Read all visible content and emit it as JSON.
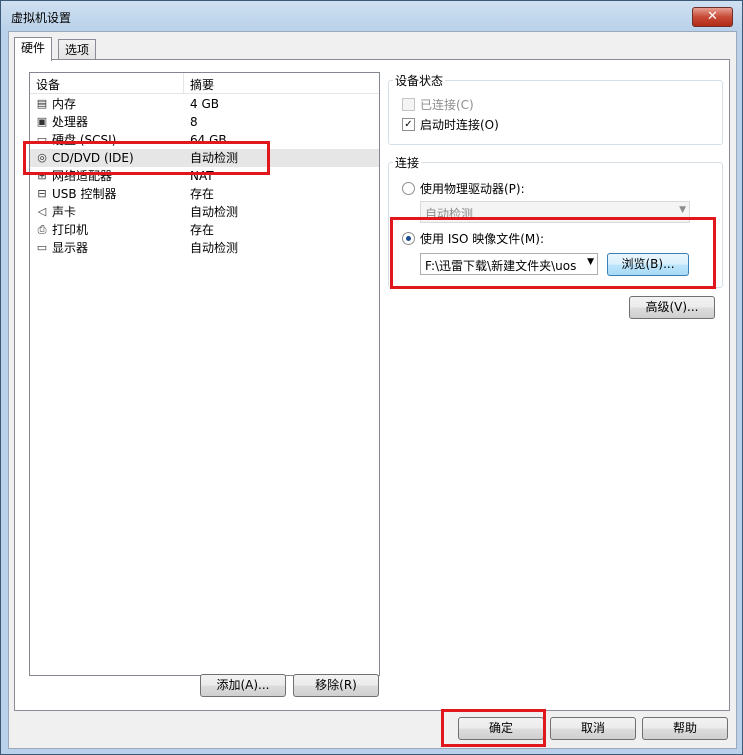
{
  "window": {
    "title": "虚拟机设置",
    "close_label": "✕"
  },
  "tabs": [
    {
      "label": "硬件",
      "active": true
    },
    {
      "label": "选项",
      "active": false
    }
  ],
  "device_list": {
    "columns": [
      "设备",
      "摘要"
    ],
    "rows": [
      {
        "icon": "memory-icon",
        "glyph": "▤",
        "name": "内存",
        "summary": "4 GB"
      },
      {
        "icon": "processor-icon",
        "glyph": "▣",
        "name": "处理器",
        "summary": "8"
      },
      {
        "icon": "hard-disk-icon",
        "glyph": "▭",
        "name": "硬盘 (SCSI)",
        "summary": "64 GB"
      },
      {
        "icon": "cd-dvd-icon",
        "glyph": "◎",
        "name": "CD/DVD (IDE)",
        "summary": "自动检测",
        "selected": true
      },
      {
        "icon": "network-adapter-icon",
        "glyph": "⊞",
        "name": "网络适配器",
        "summary": "NAT"
      },
      {
        "icon": "usb-icon",
        "glyph": "⊟",
        "name": "USB 控制器",
        "summary": "存在"
      },
      {
        "icon": "speaker-icon",
        "glyph": "◁",
        "name": "声卡",
        "summary": "自动检测"
      },
      {
        "icon": "printer-icon",
        "glyph": "⎙",
        "name": "打印机",
        "summary": "存在"
      },
      {
        "icon": "display-icon",
        "glyph": "▭",
        "name": "显示器",
        "summary": "自动检测"
      }
    ]
  },
  "device_status": {
    "label": "设备状态",
    "connected": {
      "label": "已连接(C)",
      "checked": false,
      "enabled": false
    },
    "connect_at_power_on": {
      "label": "启动时连接(O)",
      "checked": true
    }
  },
  "connection": {
    "label": "连接",
    "physical_drive": {
      "label": "使用物理驱动器(P):",
      "selected": false,
      "value": "自动检测"
    },
    "iso_image": {
      "label": "使用 ISO 映像文件(M):",
      "selected": true,
      "path": "F:\\迅雷下载\\新建文件夹\\uos"
    },
    "browse_label": "浏览(B)...",
    "advanced_label": "高级(V)..."
  },
  "list_buttons": {
    "add": "添加(A)...",
    "remove": "移除(R)"
  },
  "dialog_buttons": {
    "ok": "确定",
    "cancel": "取消",
    "help": "帮助"
  },
  "colors": {
    "highlight": "#e0181e",
    "title_bar": "#b9d1ea",
    "radio_dot": "#1a4d8e"
  }
}
